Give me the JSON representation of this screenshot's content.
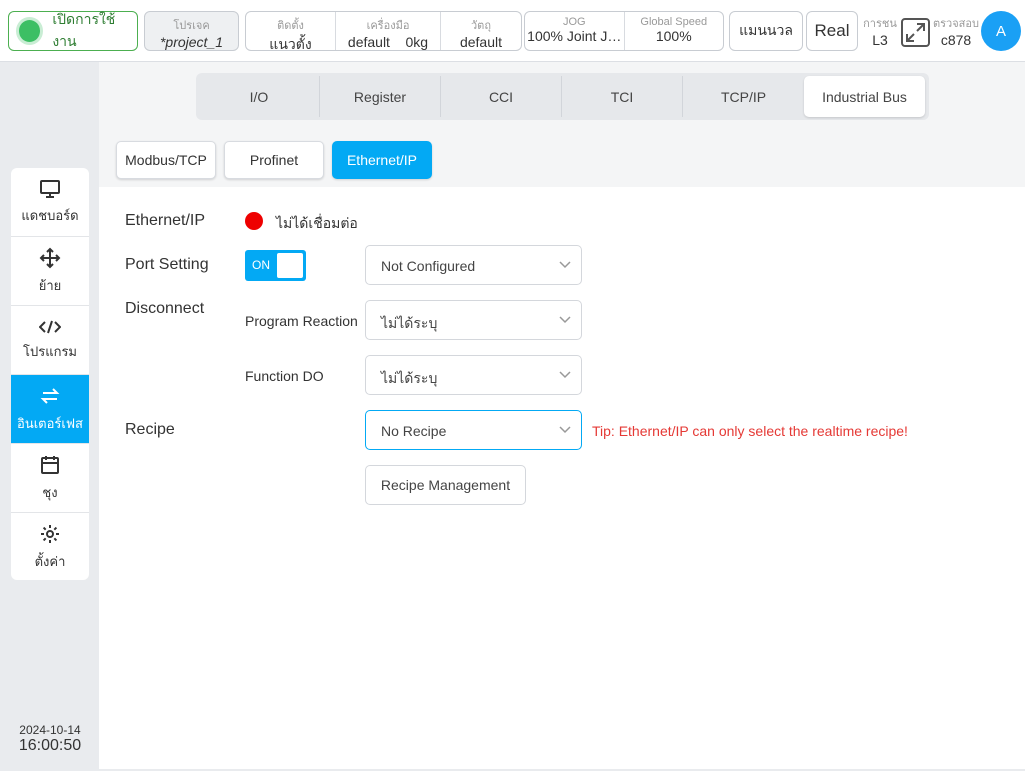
{
  "topbar": {
    "power_label": "เปิดการใช้งาน",
    "project_caption": "โปรเจค",
    "project_value": "*project_1",
    "install_caption": "ติดตั้ง",
    "install_value": "แนวตั้ง",
    "tool_caption": "เครื่องมือ",
    "tool_value": "default",
    "tool_weight": "0kg",
    "object_caption": "วัตถุ",
    "object_value": "default",
    "jog_caption": "JOG",
    "jog_value": "100%  Joint J…",
    "speed_caption": "Global Speed",
    "speed_value": "100%",
    "manual_label": "แมนนวล",
    "real_label": "Real",
    "collision_caption": "การชน",
    "collision_value": "L3",
    "check_caption": "ตรวจสอบ",
    "check_value": "c878",
    "avatar_letter": "A"
  },
  "sidebar": {
    "items": [
      {
        "label": "แดชบอร์ด",
        "icon": "monitor-icon"
      },
      {
        "label": "ย้าย",
        "icon": "move-icon"
      },
      {
        "label": "โปรแกรม",
        "icon": "code-icon"
      },
      {
        "label": "อินเตอร์เฟส",
        "icon": "swap-icon"
      },
      {
        "label": "ชุง",
        "icon": "calendar-icon"
      },
      {
        "label": "ตั้งค่า",
        "icon": "gear-icon"
      }
    ],
    "active_index": 3
  },
  "datetime": {
    "date": "2024-10-14",
    "time": "16:00:50"
  },
  "tabs": {
    "items": [
      "I/O",
      "Register",
      "CCI",
      "TCI",
      "TCP/IP",
      "Industrial Bus"
    ],
    "active": "Industrial Bus"
  },
  "subtabs": {
    "items": [
      "Modbus/TCP",
      "Profinet",
      "Ethernet/IP"
    ],
    "active": "Ethernet/IP"
  },
  "form": {
    "ethernet_label": "Ethernet/IP",
    "status_text": "ไม่ได้เชื่อมต่อ",
    "status_color": "#ee0000",
    "port_label": "Port Setting",
    "toggle_text": "ON",
    "port_value": "Not Configured",
    "disconnect_label": "Disconnect",
    "program_reaction_label": "Program Reaction",
    "program_reaction_value": "ไม่ได้ระบุ",
    "function_do_label": "Function DO",
    "function_do_value": "ไม่ได้ระบุ",
    "recipe_label": "Recipe",
    "recipe_value": "No Recipe",
    "tip": "Tip: Ethernet/IP can only select the realtime recipe!",
    "recipe_button": "Recipe Management"
  },
  "colors": {
    "accent": "#03a9f4",
    "power": "#3cbf64",
    "error": "#e53935"
  }
}
